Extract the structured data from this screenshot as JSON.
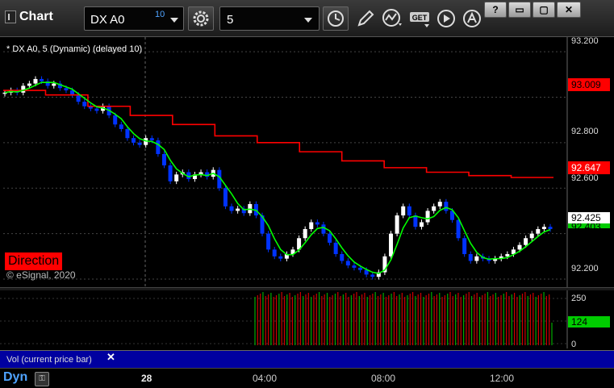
{
  "toolbar": {
    "title": "Chart",
    "symbol": "DX A0",
    "delay_badge": "10",
    "interval": "5",
    "get_label": "GET"
  },
  "window_buttons": [
    "?",
    "▭",
    "▢",
    "✕"
  ],
  "chart": {
    "study_label": "* DX A0, 5 (Dynamic) (delayed 10)",
    "direction_label": "Direction",
    "copyright": "© eSignal, 2020",
    "price_ticks": [
      "93.200",
      "92.800",
      "92.600",
      "92.200"
    ],
    "price_tags": {
      "upper_red": "93.009",
      "mid_red": "92.647",
      "last": "92.425",
      "last_under": "92.403"
    },
    "volume_ticks": [
      "250",
      "0"
    ],
    "volume_tag": "124",
    "volume_label": "Vol (current price bar)",
    "volume_close": "✕",
    "x_ticks": [
      "28",
      "04:00",
      "08:00",
      "12:00"
    ],
    "dyn_label": "Dyn",
    "colors": {
      "up_candle": "#ffffff",
      "down_candle": "#0033ff",
      "ma_red": "#ff0000",
      "ma_green": "#00ff00",
      "vol_up": "#00aa00",
      "vol_down": "#cc0000",
      "label_bg": "#ff0000"
    }
  },
  "chart_data": {
    "type": "candlestick",
    "y_range": [
      92.2,
      93.25
    ],
    "closes": [
      93.02,
      93.03,
      93.02,
      93.05,
      93.06,
      93.08,
      93.07,
      93.05,
      93.06,
      93.04,
      93.03,
      93.01,
      92.98,
      92.96,
      92.95,
      92.94,
      92.96,
      92.92,
      92.88,
      92.86,
      92.82,
      92.8,
      92.79,
      92.82,
      92.81,
      92.75,
      92.7,
      92.63,
      92.66,
      92.67,
      92.64,
      92.66,
      92.67,
      92.65,
      92.68,
      92.6,
      92.52,
      92.5,
      92.51,
      92.49,
      92.53,
      92.48,
      92.4,
      92.33,
      92.3,
      92.29,
      92.31,
      92.33,
      92.38,
      92.42,
      92.45,
      92.44,
      92.4,
      92.36,
      92.31,
      92.28,
      92.26,
      92.25,
      92.24,
      92.22,
      92.21,
      92.23,
      92.3,
      92.4,
      92.48,
      92.52,
      92.48,
      92.43,
      92.45,
      92.5,
      92.52,
      92.54,
      92.5,
      92.46,
      92.38,
      92.31,
      92.28,
      92.3,
      92.29,
      92.28,
      92.29,
      92.3,
      92.31,
      92.33,
      92.35,
      92.38,
      92.4,
      92.42,
      92.43,
      92.42
    ],
    "ma_red_steps": [
      93.03,
      93.01,
      92.96,
      92.92,
      92.88,
      92.83,
      92.8,
      92.76,
      92.72,
      92.69,
      92.67,
      92.655,
      92.647
    ],
    "volume_max": 250,
    "volume_last": 124
  }
}
